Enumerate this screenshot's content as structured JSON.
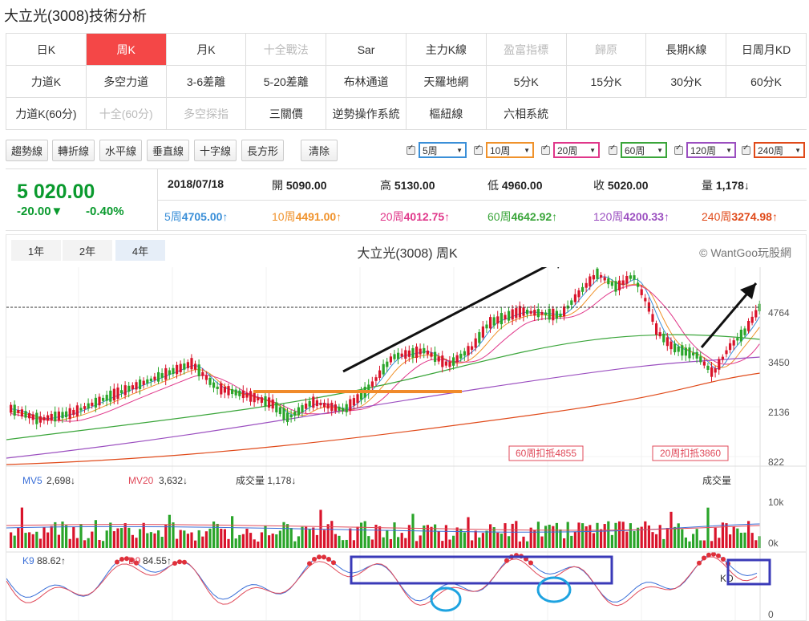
{
  "page": {
    "title": "大立光(3008)技術分析"
  },
  "tabs": [
    [
      {
        "label": "日K",
        "state": "normal"
      },
      {
        "label": "周K",
        "state": "active"
      },
      {
        "label": "月K",
        "state": "normal"
      },
      {
        "label": "十全戰法",
        "state": "disabled"
      },
      {
        "label": "Sar",
        "state": "normal"
      },
      {
        "label": "主力K線",
        "state": "normal"
      },
      {
        "label": "盈富指標",
        "state": "disabled"
      },
      {
        "label": "歸原",
        "state": "disabled"
      },
      {
        "label": "長期K線",
        "state": "normal"
      },
      {
        "label": "日周月KD",
        "state": "normal"
      }
    ],
    [
      {
        "label": "力道K",
        "state": "normal"
      },
      {
        "label": "多空力道",
        "state": "normal"
      },
      {
        "label": "3-6差離",
        "state": "normal"
      },
      {
        "label": "5-20差離",
        "state": "normal"
      },
      {
        "label": "布林通道",
        "state": "normal"
      },
      {
        "label": "天羅地網",
        "state": "normal"
      },
      {
        "label": "5分K",
        "state": "normal"
      },
      {
        "label": "15分K",
        "state": "normal"
      },
      {
        "label": "30分K",
        "state": "normal"
      },
      {
        "label": "60分K",
        "state": "normal"
      }
    ],
    [
      {
        "label": "力道K(60分)",
        "state": "normal"
      },
      {
        "label": "十全(60分)",
        "state": "disabled"
      },
      {
        "label": "多空探指",
        "state": "disabled"
      },
      {
        "label": "三關價",
        "state": "normal"
      },
      {
        "label": "逆勢操作系統",
        "state": "normal"
      },
      {
        "label": "樞紐線",
        "state": "normal"
      },
      {
        "label": "六相系統",
        "state": "normal"
      }
    ]
  ],
  "tools": {
    "trend": "趨勢線",
    "zigzag": "轉折線",
    "horizontal": "水平線",
    "vertical": "垂直線",
    "cross": "十字線",
    "rect": "長方形",
    "clear": "清除"
  },
  "ma_selects": [
    {
      "label": "5周",
      "color": "#3a8fd8"
    },
    {
      "label": "10周",
      "color": "#f0922b"
    },
    {
      "label": "20周",
      "color": "#e0378a"
    },
    {
      "label": "60周",
      "color": "#3aa53a"
    },
    {
      "label": "120周",
      "color": "#9b4fc0"
    },
    {
      "label": "240周",
      "color": "#e04a1a"
    }
  ],
  "quote": {
    "price": "5 020.00",
    "change": "-20.00▼",
    "pct": "-0.40%",
    "date": "2018/07/18",
    "open_label": "開",
    "open": "5090.00",
    "high_label": "高",
    "high": "5130.00",
    "low_label": "低",
    "low": "4960.00",
    "close_label": "收",
    "close": "5020.00",
    "vol_label": "量",
    "vol": "1,178↓",
    "mas": [
      {
        "label": "5周",
        "value": "4705.00↑",
        "color": "#3a8fd8"
      },
      {
        "label": "10周",
        "value": "4491.00↑",
        "color": "#f0922b"
      },
      {
        "label": "20周",
        "value": "4012.75↑",
        "color": "#e0378a"
      },
      {
        "label": "60周",
        "value": "4642.92↑",
        "color": "#3aa53a"
      },
      {
        "label": "120周",
        "value": "4200.33↑",
        "color": "#9b4fc0"
      },
      {
        "label": "240周",
        "value": "3274.98↑",
        "color": "#e04a1a"
      }
    ]
  },
  "chart": {
    "ranges": [
      "1年",
      "2年",
      "4年"
    ],
    "title": "大立光(3008) 周K",
    "brand": "© WantGoo玩股網",
    "price_ticks": [
      "4764",
      "3450",
      "2136",
      "822"
    ],
    "tag_60": "60周扣抵4855",
    "tag_20": "20周扣抵3860",
    "vol_mv5_label": "MV5",
    "vol_mv5": "2,698↓",
    "vol_mv20_label": "MV20",
    "vol_mv20": "3,632↓",
    "vol_label": "成交量 1,178↓",
    "vol_right_label": "成交量",
    "vol_ticks": [
      "10k",
      "0k"
    ],
    "kd_k_label": "K9",
    "kd_k": "88.62↑",
    "kd_d_label": "D9",
    "kd_d": "84.55↑",
    "kd_right_label": "KD",
    "kd_ticks": [
      "0"
    ]
  }
}
